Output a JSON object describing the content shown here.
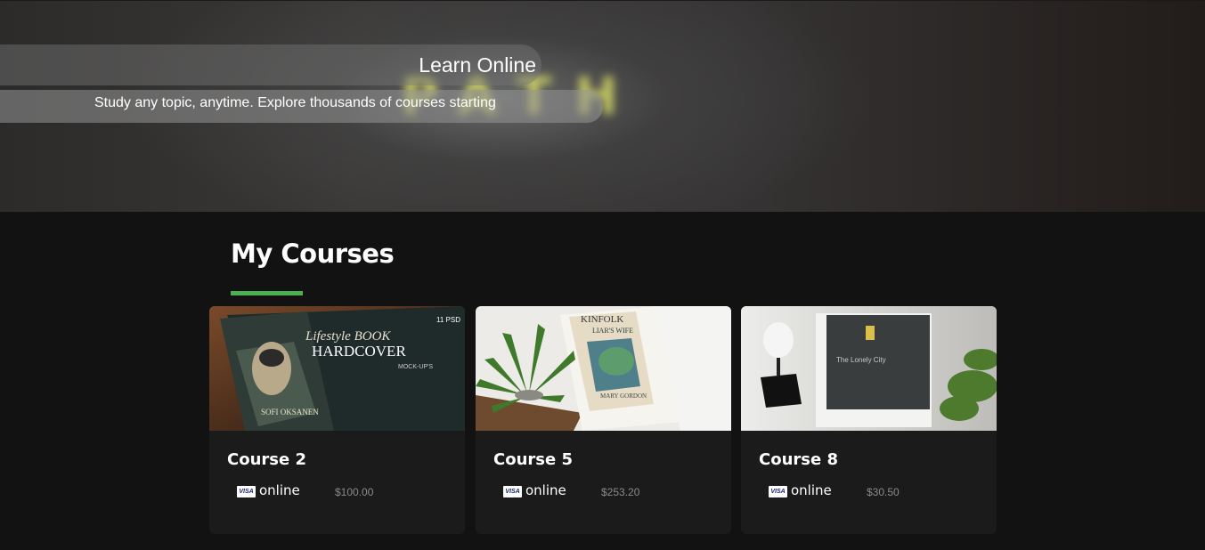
{
  "hero": {
    "title": "Learn Online",
    "subtitle": "Study any topic, anytime. Explore thousands of courses starting",
    "background_word": "PATH"
  },
  "section": {
    "title": "My Courses",
    "accent_color": "#4caf50"
  },
  "courses": [
    {
      "name": "Course 2",
      "payment_icon": "visa-card-icon",
      "payment_label": "VISA",
      "mode": "online",
      "price": "$100.00",
      "image": "book-hardcover-mockup",
      "image_text": {
        "psd": "11 PSD",
        "line1": "Lifestyle BOOK",
        "line2": "HARDCOVER",
        "line3": "MOCK-UP'S",
        "author": "SOFI OKSANEN"
      }
    },
    {
      "name": "Course 5",
      "payment_icon": "visa-card-icon",
      "payment_label": "VISA",
      "mode": "online",
      "price": "$253.20",
      "image": "books-with-plant",
      "image_text": {
        "top": "KINFOLK",
        "book_title": "LIAR'S WIFE",
        "author": "MARY GORDON"
      }
    },
    {
      "name": "Course 8",
      "payment_icon": "visa-card-icon",
      "payment_label": "VISA",
      "mode": "online",
      "price": "$30.50",
      "image": "lonely-city-book-with-bust",
      "image_text": {
        "book_title": "The Lonely City"
      }
    }
  ]
}
